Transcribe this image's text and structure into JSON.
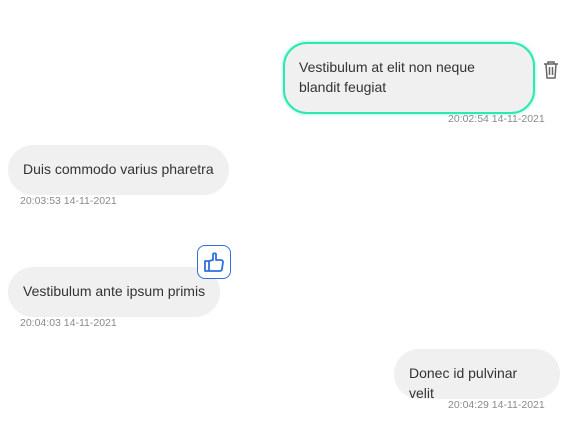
{
  "messages": [
    {
      "text": "Vestibulum at elit non neque blandit feugiat",
      "time": "20:02:54 14-11-2021",
      "side": "right",
      "selected": true
    },
    {
      "text": "Duis commodo varius pharetra",
      "time": "20:03:53 14-11-2021",
      "side": "left"
    },
    {
      "text": "Vestibulum ante ipsum primis",
      "time": "20:04:03 14-11-2021",
      "side": "left",
      "reaction": "thumbs-up-icon"
    },
    {
      "text": "Donec id pulvinar velit",
      "time": "20:04:29 14-11-2021",
      "side": "right"
    }
  ],
  "colors": {
    "selected_border": "#2de8b0",
    "reaction": "#2f6fe0",
    "bubble": "#f0f0f0"
  }
}
